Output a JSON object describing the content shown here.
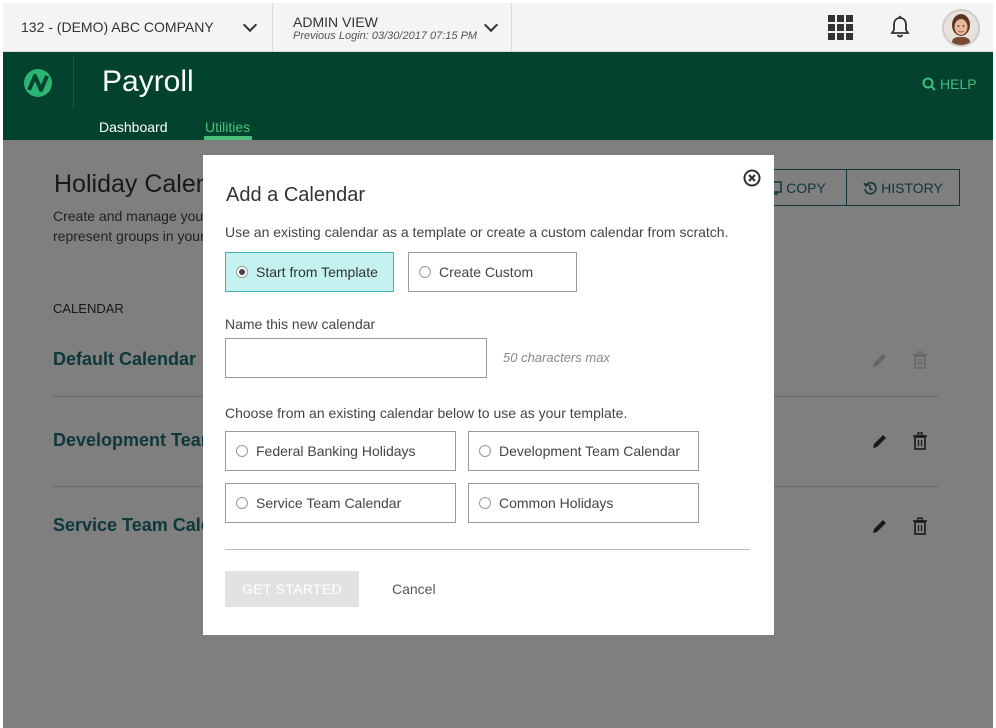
{
  "topbar": {
    "company": "132 - (DEMO) ABC COMPANY",
    "admin_view": "ADMIN VIEW",
    "previous_login": "Previous Login: 03/30/2017 07:15 PM"
  },
  "app": {
    "title": "Payroll",
    "help": "HELP",
    "tabs": [
      {
        "label": "Dashboard",
        "active": false
      },
      {
        "label": "Utilities",
        "active": true
      }
    ]
  },
  "page": {
    "title": "Holiday Calend",
    "description_line1": "Create and manage your c",
    "description_line2": "represent groups in your c",
    "actions": {
      "copy": "COPY",
      "history": "HISTORY"
    },
    "column_header": "CALENDAR",
    "calendars": [
      {
        "name": "Default Calendar",
        "editable": false
      },
      {
        "name": "Development Team",
        "editable": true
      },
      {
        "name": "Service Team  Calen",
        "editable": true
      }
    ]
  },
  "modal": {
    "title": "Add a Calendar",
    "description": "Use an existing calendar as a template or create a custom calendar from scratch.",
    "mode_options": [
      {
        "label": "Start from Template",
        "selected": true
      },
      {
        "label": "Create Custom",
        "selected": false
      }
    ],
    "name_label": "Name this new calendar",
    "name_value": "",
    "name_hint": "50 characters max",
    "choose_label": "Choose from an existing calendar below to use as your template.",
    "templates": [
      {
        "label": "Federal Banking Holidays",
        "selected": false
      },
      {
        "label": "Development Team Calendar",
        "selected": false
      },
      {
        "label": "Service Team Calendar",
        "selected": false
      },
      {
        "label": "Common Holidays",
        "selected": false
      }
    ],
    "get_started": "GET STARTED",
    "cancel": "Cancel"
  },
  "colors": {
    "header_bg": "#02422f",
    "accent_green": "#49c17a",
    "teal_link": "#1d7178",
    "selected_option_bg": "#c6f1f1"
  }
}
